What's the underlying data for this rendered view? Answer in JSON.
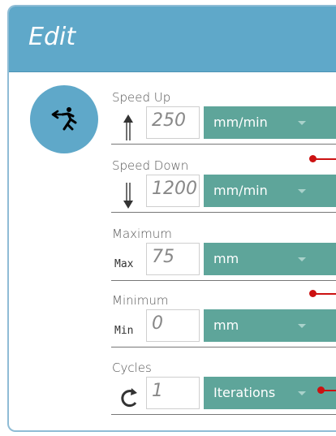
{
  "header": {
    "title": "Edit"
  },
  "mode_icon": "running-person-arrow-icon",
  "fields": [
    {
      "label": "Speed Up",
      "icon": "double-arrow-up-icon",
      "value": "250",
      "unit": "mm/min"
    },
    {
      "label": "Speed Down",
      "icon": "double-arrow-down-icon",
      "value": "1200",
      "unit": "mm/min"
    },
    {
      "label": "Maximum",
      "prefix": "Max",
      "value": "75",
      "unit": "mm"
    },
    {
      "label": "Minimum",
      "prefix": "Min",
      "value": "0",
      "unit": "mm"
    },
    {
      "label": "Cycles",
      "icon": "refresh-cycle-icon",
      "value": "1",
      "unit": "Iterations"
    }
  ],
  "colors": {
    "header": "#5fa8c9",
    "select": "#5ea59a",
    "marker": "#cc1111"
  }
}
